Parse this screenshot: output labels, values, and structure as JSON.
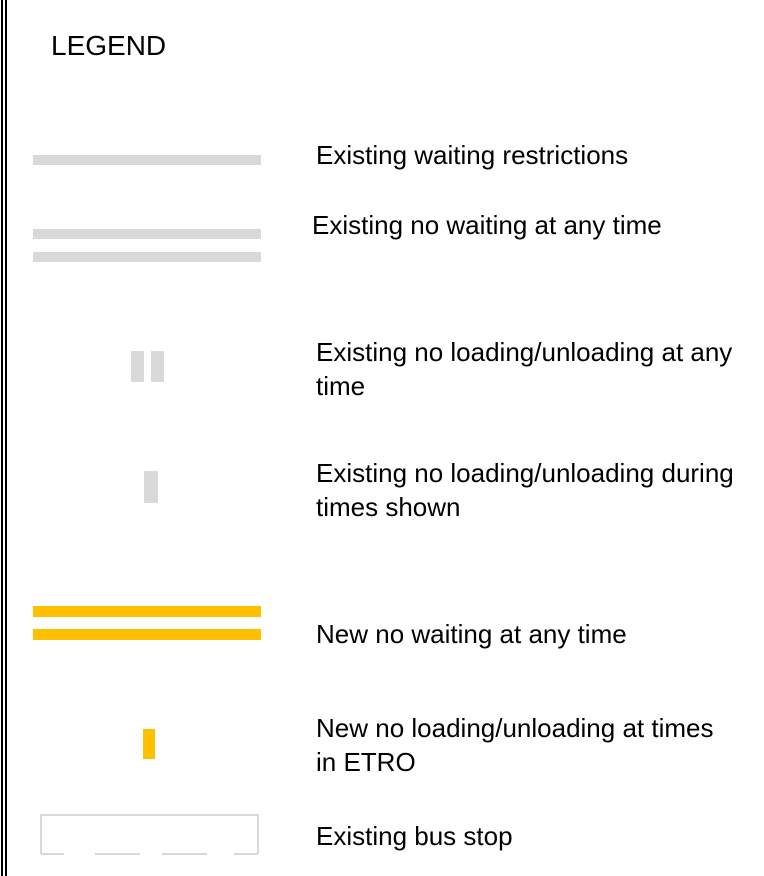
{
  "legend": {
    "title": "LEGEND",
    "items": [
      {
        "symbol": "single-gray-line",
        "label": "Existing waiting restrictions"
      },
      {
        "symbol": "double-gray-line",
        "label": "Existing no waiting at any time"
      },
      {
        "symbol": "double-gray-mark",
        "label": "Existing no loading/unloading at any time"
      },
      {
        "symbol": "single-gray-mark",
        "label": "Existing no loading/unloading during times shown"
      },
      {
        "symbol": "double-yellow-line",
        "label": "New no waiting at any time"
      },
      {
        "symbol": "single-yellow-mark",
        "label": "New no loading/unloading at times in ETRO"
      },
      {
        "symbol": "bus-stop-outline",
        "label": "Existing bus stop"
      }
    ]
  },
  "colors": {
    "existing": "#d9d9d9",
    "new": "#ffc000",
    "border": "#000000"
  }
}
